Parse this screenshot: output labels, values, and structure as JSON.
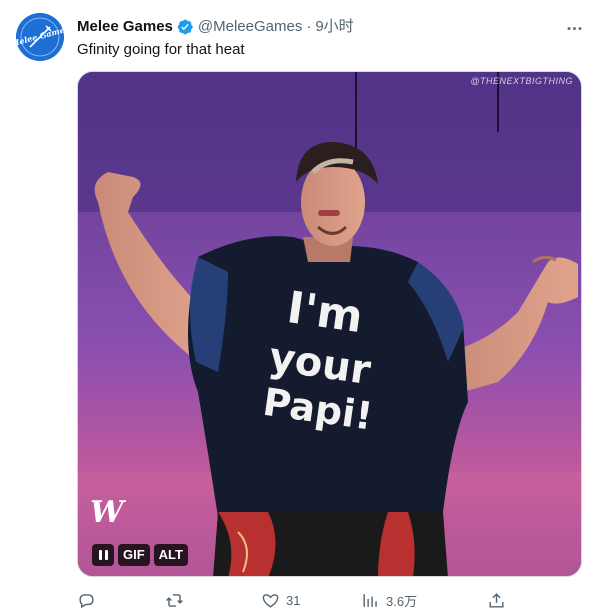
{
  "tweet": {
    "author_name": "Melee Games",
    "handle": "@MeleeGames",
    "separator": "·",
    "time": "9小时",
    "text": "Gfinity going for that heat",
    "avatar_text": "Melee Games"
  },
  "media": {
    "watermark": "@THENEXTBIGTHING",
    "shirt_lines": [
      "I'm",
      "your",
      "Papi!"
    ],
    "badges": {
      "gif": "GIF",
      "alt": "ALT"
    },
    "logo_text": "W"
  },
  "actions": {
    "reply_count": "",
    "retweet_count": "",
    "like_count": "31",
    "views_count": "3.6万"
  },
  "colors": {
    "verified": "#1d9bf0",
    "text_primary": "#0f1419",
    "text_secondary": "#536471",
    "avatar_bg": "#1d6fd6"
  },
  "icons": {
    "verified": "verified-badge-icon",
    "more": "more-dots-icon",
    "reply": "reply-icon",
    "retweet": "retweet-icon",
    "like": "heart-icon",
    "views": "views-chart-icon",
    "share": "share-icon"
  }
}
